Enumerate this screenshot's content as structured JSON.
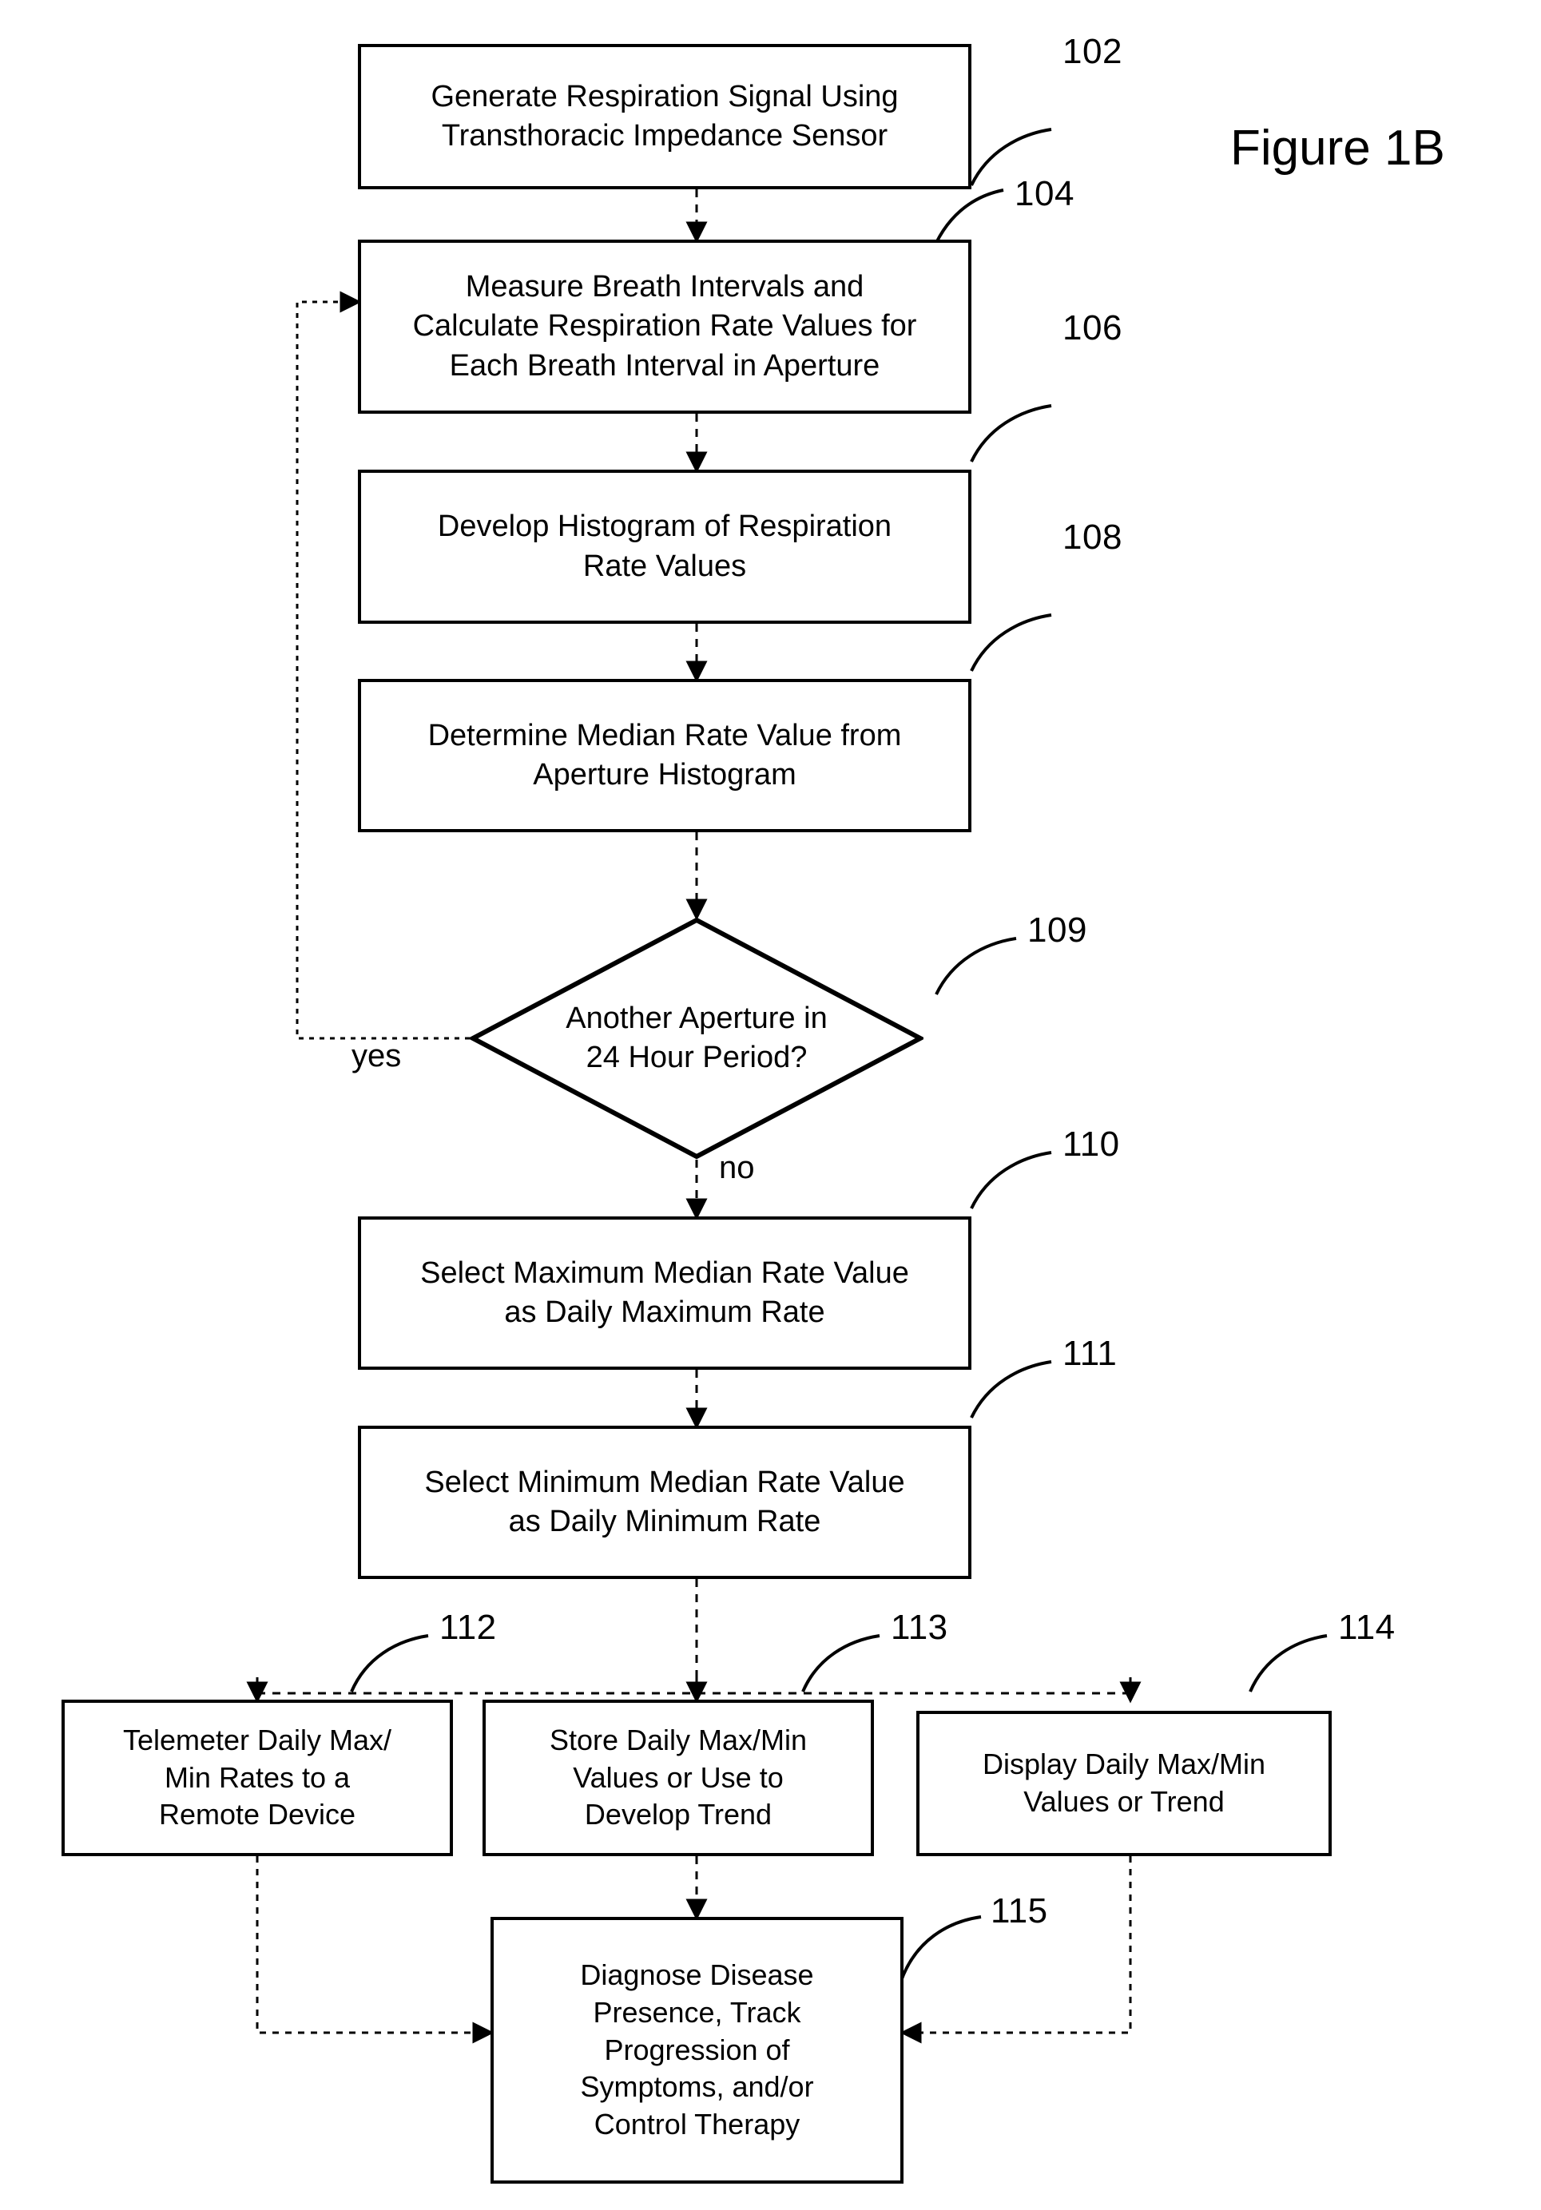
{
  "figure": {
    "title": "Figure 1B"
  },
  "edge_labels": {
    "yes": "yes",
    "no": "no"
  },
  "nodes": [
    {
      "id": "102",
      "ref": "102",
      "shape": "process",
      "text": "Generate Respiration Signal Using\nTransthoracic Impedance Sensor"
    },
    {
      "id": "104",
      "ref": "104",
      "shape": "process",
      "text": "Measure Breath Intervals and\nCalculate Respiration Rate Values for\nEach Breath Interval in Aperture"
    },
    {
      "id": "106",
      "ref": "106",
      "shape": "process",
      "text": "Develop Histogram of Respiration\nRate Values"
    },
    {
      "id": "108",
      "ref": "108",
      "shape": "process",
      "text": "Determine Median Rate Value from\nAperture Histogram"
    },
    {
      "id": "109",
      "ref": "109",
      "shape": "decision",
      "text": "Another Aperture in\n24 Hour Period?"
    },
    {
      "id": "110",
      "ref": "110",
      "shape": "process",
      "text": "Select Maximum Median Rate Value\nas Daily Maximum Rate"
    },
    {
      "id": "111",
      "ref": "111",
      "shape": "process",
      "text": "Select Minimum Median Rate Value\nas Daily Minimum Rate"
    },
    {
      "id": "112",
      "ref": "112",
      "shape": "process",
      "text": "Telemeter Daily Max/\nMin Rates to a\nRemote Device"
    },
    {
      "id": "113",
      "ref": "113",
      "shape": "process",
      "text": "Store Daily Max/Min\nValues or Use to\nDevelop Trend"
    },
    {
      "id": "114",
      "ref": "114",
      "shape": "process",
      "text": "Display Daily Max/Min\nValues or Trend"
    },
    {
      "id": "115",
      "ref": "115",
      "shape": "process",
      "text": "Diagnose Disease\nPresence, Track\nProgression of\nSymptoms, and/or\nControl Therapy"
    }
  ],
  "colors": {
    "stroke": "#000000",
    "background": "#ffffff",
    "text": "#000000"
  }
}
